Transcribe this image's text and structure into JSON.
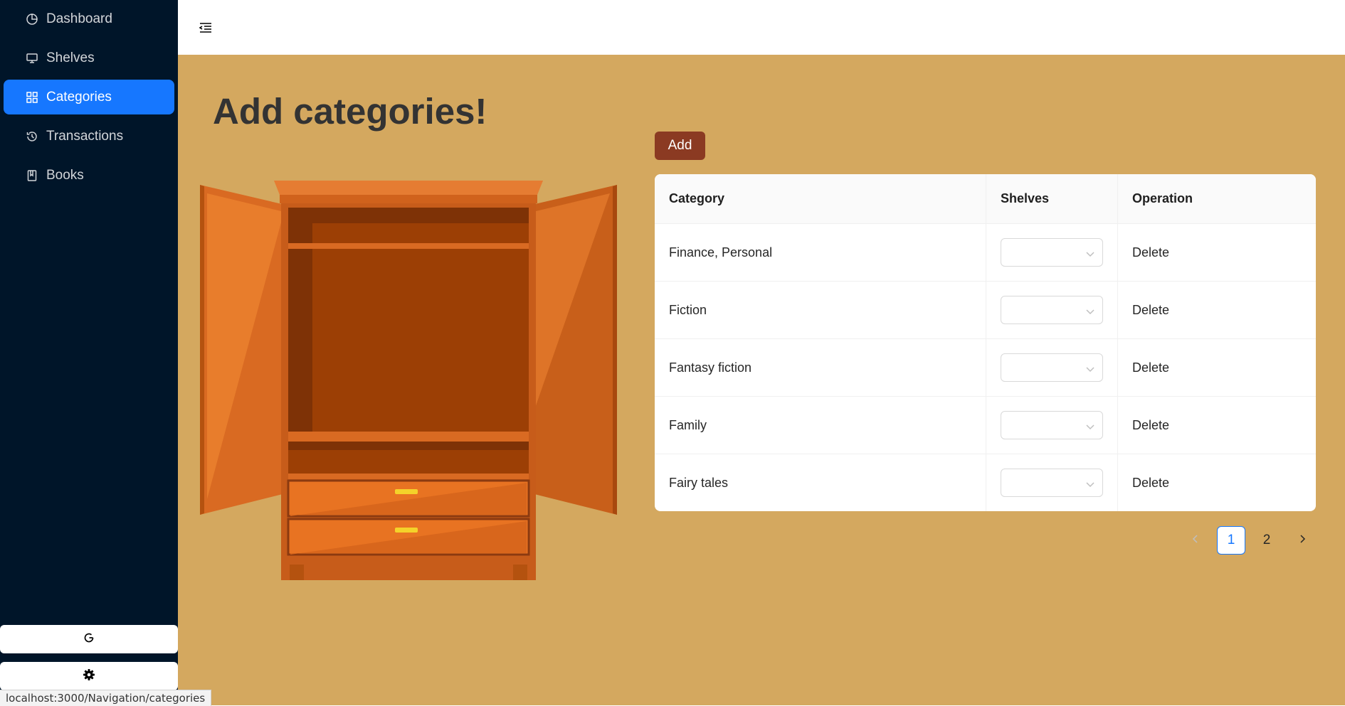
{
  "sidebar": {
    "items": [
      {
        "label": "Dashboard",
        "icon": "pie-chart-icon"
      },
      {
        "label": "Shelves",
        "icon": "desktop-icon"
      },
      {
        "label": "Categories",
        "icon": "appstore-icon",
        "active": true
      },
      {
        "label": "Transactions",
        "icon": "history-icon"
      },
      {
        "label": "Books",
        "icon": "book-icon"
      }
    ],
    "bottom_buttons": [
      {
        "icon": "reload-icon"
      },
      {
        "icon": "settings-icon"
      }
    ]
  },
  "header": {
    "collapse_icon": "menu-fold-icon"
  },
  "main": {
    "title": "Add categories!",
    "add_label": "Add",
    "table": {
      "headers": [
        "Category",
        "Shelves",
        "Operation"
      ],
      "rows": [
        {
          "category": "Finance, Personal",
          "shelves": "",
          "operation": "Delete"
        },
        {
          "category": "Fiction",
          "shelves": "",
          "operation": "Delete"
        },
        {
          "category": "Fantasy fiction",
          "shelves": "",
          "operation": "Delete"
        },
        {
          "category": "Family",
          "shelves": "",
          "operation": "Delete"
        },
        {
          "category": "Fairy tales",
          "shelves": "",
          "operation": "Delete"
        }
      ]
    },
    "pagination": {
      "pages": [
        "1",
        "2"
      ],
      "current": "1"
    }
  },
  "status_bar": "localhost:3000/Navigation/categories",
  "colors": {
    "sidebar_bg": "#001529",
    "active_item": "#1677ff",
    "main_bg": "#d4a85f",
    "add_button": "#8b3a22"
  }
}
